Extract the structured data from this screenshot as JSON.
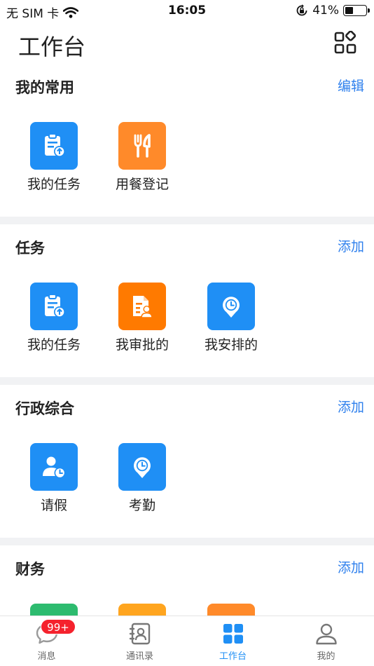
{
  "status_bar": {
    "carrier": "无 SIM 卡",
    "time": "16:05",
    "battery_text": "41%",
    "battery_level": 0.41
  },
  "header": {
    "title": "工作台"
  },
  "sections": [
    {
      "title": "我的常用",
      "action": "编辑",
      "items": [
        {
          "label": "我的任务",
          "icon": "task-upload-icon",
          "color": "#1f8ff5"
        },
        {
          "label": "用餐登记",
          "icon": "fork-knife-icon",
          "color": "#ff8a2a"
        }
      ]
    },
    {
      "title": "任务",
      "action": "添加",
      "items": [
        {
          "label": "我的任务",
          "icon": "task-upload-icon",
          "color": "#1f8ff5"
        },
        {
          "label": "我审批的",
          "icon": "approval-doc-icon",
          "color": "#ff7a00"
        },
        {
          "label": "我安排的",
          "icon": "clock-pin-icon",
          "color": "#1f8ff5"
        }
      ]
    },
    {
      "title": "行政综合",
      "action": "添加",
      "items": [
        {
          "label": "请假",
          "icon": "user-clock-icon",
          "color": "#1f8ff5"
        },
        {
          "label": "考勤",
          "icon": "clock-pin-icon",
          "color": "#1f8ff5"
        }
      ]
    },
    {
      "title": "财务",
      "action": "添加",
      "items": []
    }
  ],
  "tabbar": {
    "tabs": [
      {
        "label": "消息",
        "icon": "chat-bubble-icon",
        "badge": "99+"
      },
      {
        "label": "通讯录",
        "icon": "contacts-book-icon"
      },
      {
        "label": "工作台",
        "icon": "grid-apps-icon",
        "active": true
      },
      {
        "label": "我的",
        "icon": "person-icon"
      }
    ]
  }
}
